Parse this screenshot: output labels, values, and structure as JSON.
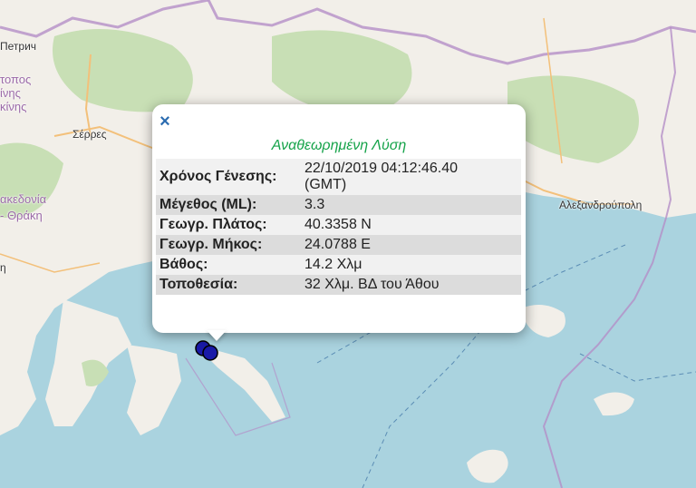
{
  "map": {
    "labels": {
      "petrich": "Петрич",
      "serres": "Σέρρες",
      "alexandroupoli": "Αλεξανδρούπολη",
      "region_top_1": "τοπος",
      "region_top_2": "ίνης",
      "region_top_3": "κίνης",
      "region_macedonia_1": "ακεδονία",
      "region_macedonia_2": "- Θράκη",
      "left_edge": "η"
    },
    "colors": {
      "sea": "#aad3df",
      "land": "#f2efe9",
      "forest": "#c8dfb5",
      "border": "#b48fc7"
    }
  },
  "popup": {
    "close_symbol": "×",
    "title": "Αναθεωρημένη Λύση",
    "rows": [
      {
        "label": "Χρόνος Γένεσης:",
        "value_line1": "22/10/2019 04:12:46.40",
        "value_line2": "(GMT)"
      },
      {
        "label": "Μέγεθος (ML):",
        "value": "3.3"
      },
      {
        "label": "Γεωγρ. Πλάτος:",
        "value": "40.3358 N"
      },
      {
        "label": "Γεωγρ. Μήκος:",
        "value": "24.0788 E"
      },
      {
        "label": "Βάθος:",
        "value": "14.2 Χλμ"
      },
      {
        "label": "Τοποθεσία:",
        "value": "32 Χλμ. ΒΔ του Άθου"
      }
    ]
  },
  "markers": [
    {
      "name": "earthquake-marker",
      "color": "#1a1aa8"
    }
  ]
}
